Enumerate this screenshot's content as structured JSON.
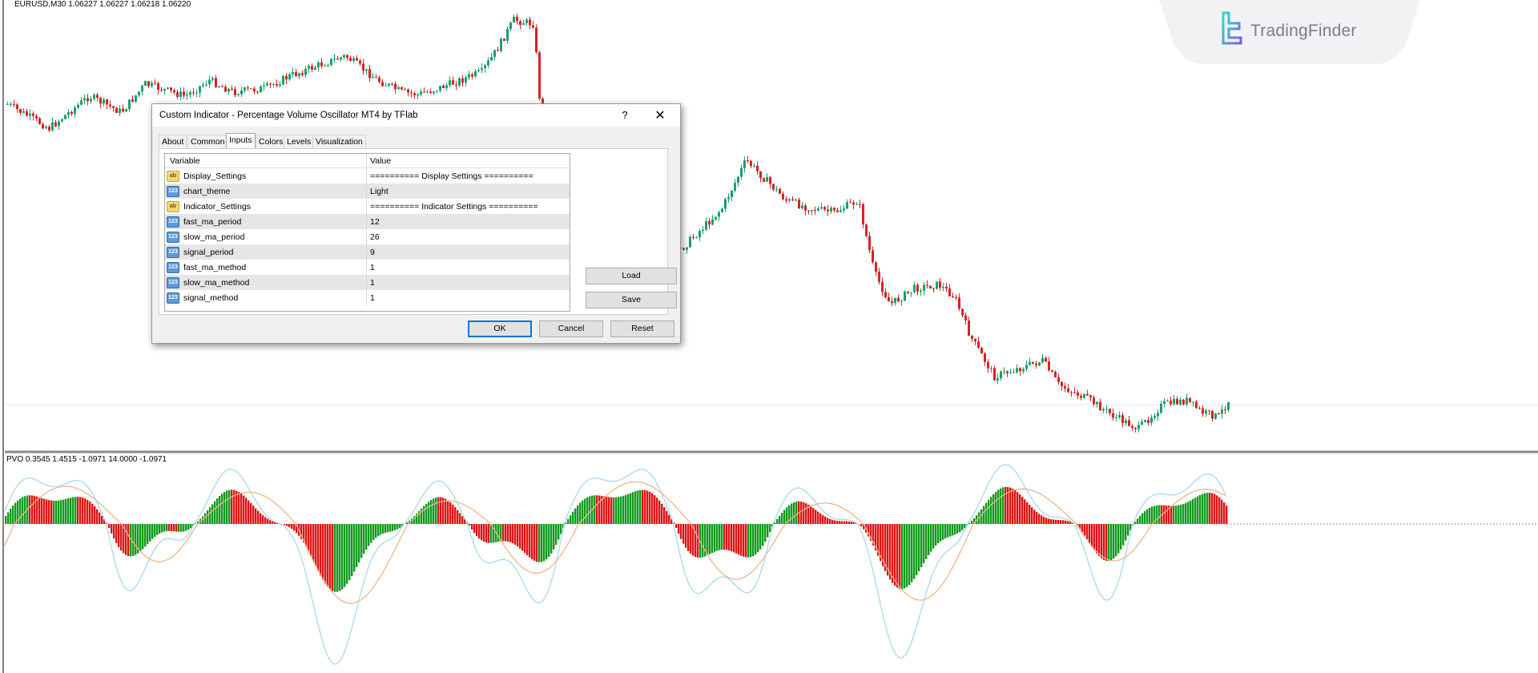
{
  "chart": {
    "price_label": "EURUSD,M30  1.06227 1.06227 1.06218 1.06220",
    "pvo_label": "PVO 0.3545 1.4515 -1.0971 14.0000 -1.0971",
    "colors": {
      "candle_up": "#1aa06b",
      "candle_down": "#d72323",
      "hist_up": "#109a1c",
      "hist_down": "#e01212",
      "pvo_line": "#a8d8f0",
      "signal_line": "#f0b48a",
      "divider": "#8a8a8a"
    }
  },
  "logo": {
    "text": "TradingFinder",
    "icon": "tradingfinder-logo-icon"
  },
  "dialog": {
    "title": "Custom Indicator - Percentage Volume Oscillator MT4 by TFlab",
    "help": "?",
    "close": "✕",
    "tabs": [
      "About",
      "Common",
      "Inputs",
      "Colors",
      "Levels",
      "Visualization"
    ],
    "active_tab": "Inputs",
    "table": {
      "headers": {
        "variable": "Variable",
        "value": "Value"
      },
      "rows": [
        {
          "type": "ab",
          "variable": "Display_Settings",
          "value": "========== Display Settings =========="
        },
        {
          "type": "123",
          "variable": "chart_theme",
          "value": "Light"
        },
        {
          "type": "ab",
          "variable": "Indicator_Settings",
          "value": "========== Indicator Settings =========="
        },
        {
          "type": "123",
          "variable": "fast_ma_period",
          "value": "12"
        },
        {
          "type": "123",
          "variable": "slow_ma_period",
          "value": "26"
        },
        {
          "type": "123",
          "variable": "signal_period",
          "value": "9"
        },
        {
          "type": "123",
          "variable": "fast_ma_method",
          "value": "1"
        },
        {
          "type": "123",
          "variable": "slow_ma_method",
          "value": "1"
        },
        {
          "type": "123",
          "variable": "signal_method",
          "value": "1"
        }
      ]
    },
    "buttons": {
      "load": "Load",
      "save": "Save",
      "ok": "OK",
      "cancel": "Cancel",
      "reset": "Reset"
    }
  }
}
